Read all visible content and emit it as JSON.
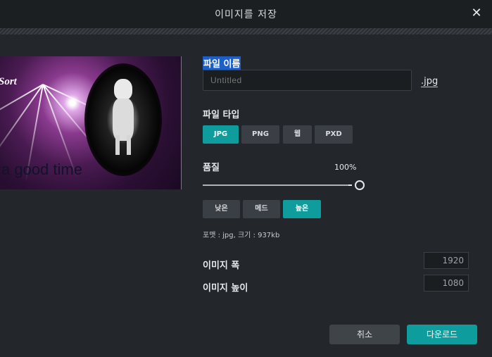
{
  "dialog": {
    "title": "이미지를 저장",
    "close_label": "✕"
  },
  "preview": {
    "caption": "a good time",
    "logo_text": "Sort"
  },
  "filename": {
    "label": "파일 이름",
    "value": "",
    "placeholder": "Untitled",
    "extension": ".jpg"
  },
  "filetype": {
    "label": "파일 타입",
    "options": [
      {
        "label": "JPG",
        "selected": true
      },
      {
        "label": "PNG",
        "selected": false
      },
      {
        "label": "웹",
        "selected": false
      },
      {
        "label": "PXD",
        "selected": false
      }
    ]
  },
  "quality": {
    "label": "품질",
    "percent_label": "100%",
    "value": 1.0,
    "presets": [
      {
        "label": "낮은",
        "selected": false
      },
      {
        "label": "메드",
        "selected": false
      },
      {
        "label": "높은",
        "selected": true
      }
    ]
  },
  "info": "포맷 : jpg, 크기 : 937kb",
  "dimensions": {
    "width_label": "이미지 폭",
    "width_value": "1920",
    "height_label": "이미지 높이",
    "height_value": "1080"
  },
  "footer": {
    "cancel_label": "취소",
    "download_label": "다운로드"
  },
  "colors": {
    "accent": "#0e9c9c",
    "background": "#23272b",
    "selection": "#1e5fc7"
  }
}
